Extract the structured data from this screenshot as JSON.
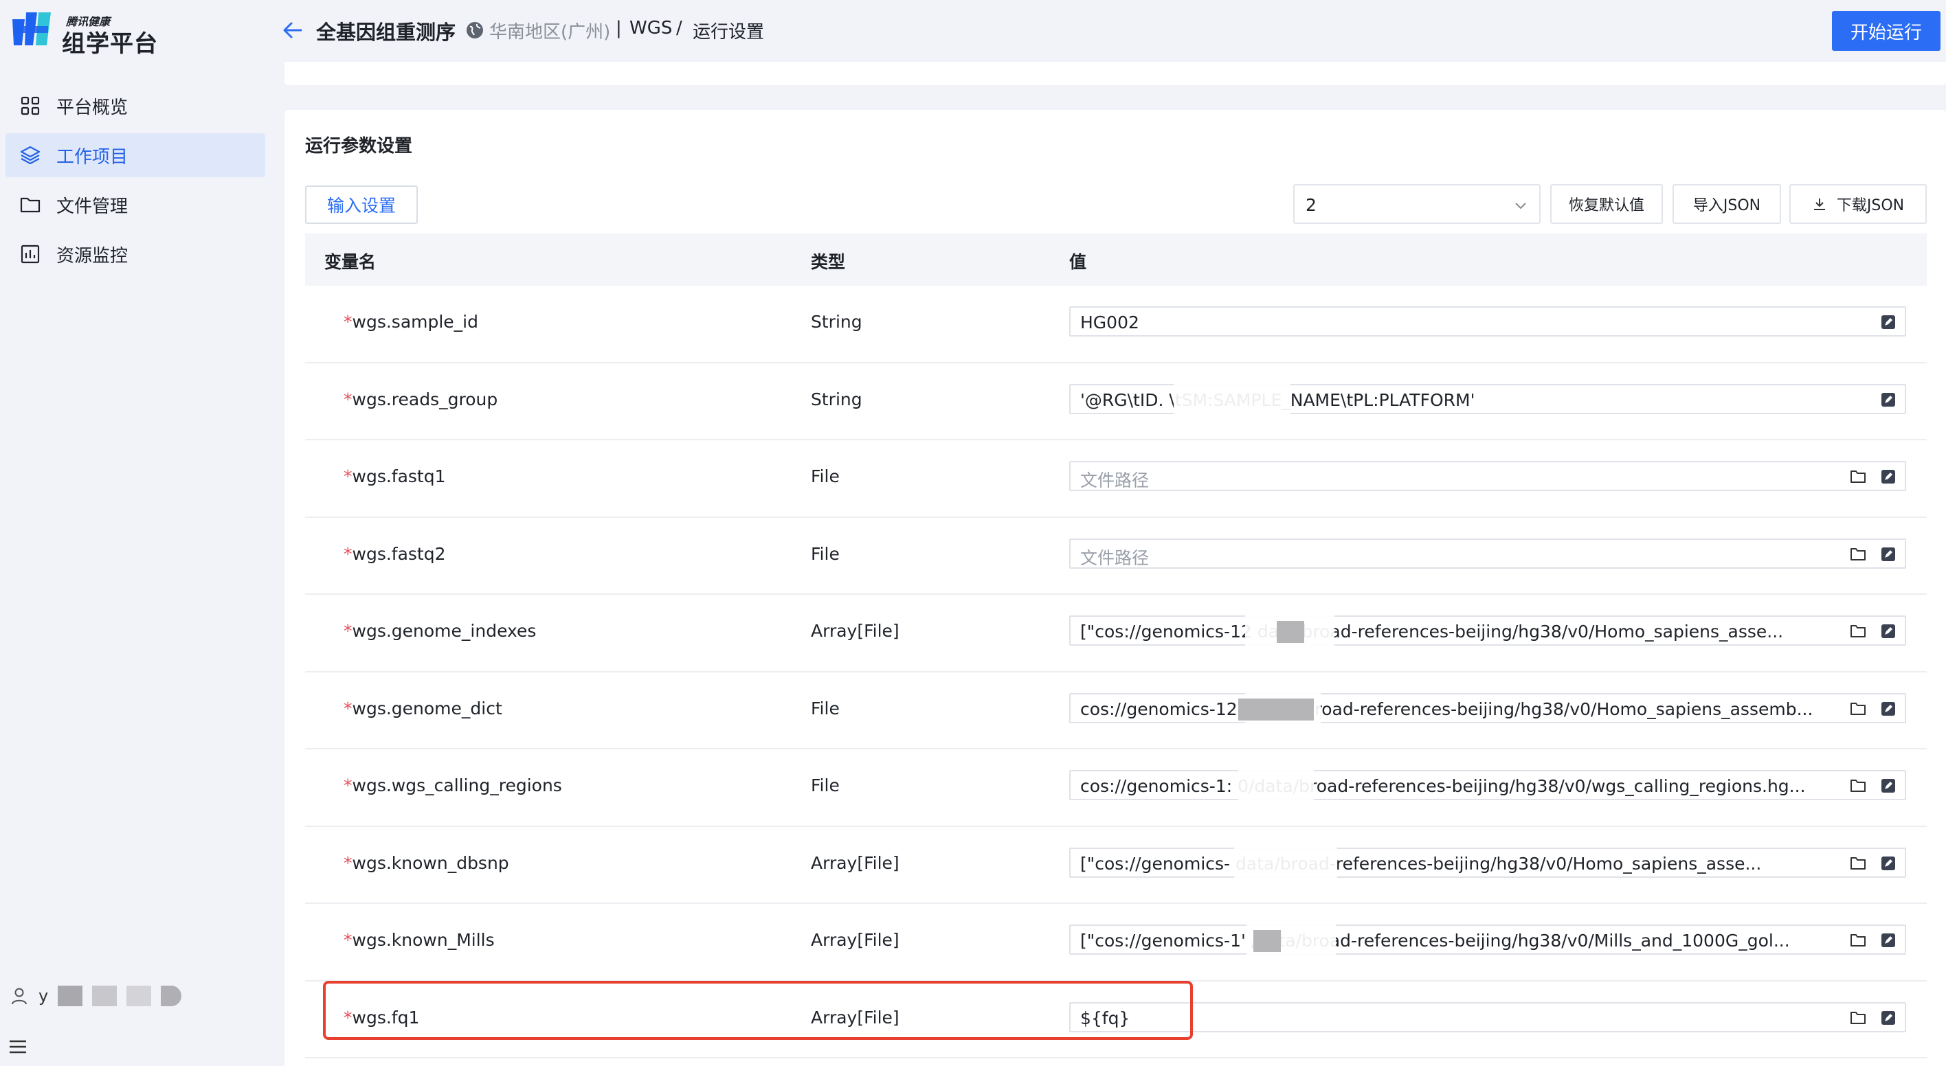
{
  "brand": {
    "small": "腾讯健康",
    "big": "组学平台"
  },
  "sidebar": {
    "items": [
      {
        "label": "平台概览",
        "icon": "grid-icon",
        "active": false
      },
      {
        "label": "工作项目",
        "icon": "layers-icon",
        "active": true
      },
      {
        "label": "文件管理",
        "icon": "folder-icon",
        "active": false
      },
      {
        "label": "资源监控",
        "icon": "chart-icon",
        "active": false
      }
    ],
    "user_initial": "y"
  },
  "header": {
    "title": "全基因组重测序",
    "region": "华南地区(广州)",
    "sep1": "|",
    "project": "WGS",
    "sep2": "/",
    "page": "运行设置",
    "start_button": "开始运行"
  },
  "params": {
    "title": "运行参数设置",
    "tab": "输入设置",
    "select_value": "2",
    "restore_button": "恢复默认值",
    "import_button": "导入JSON",
    "download_button": "下载JSON",
    "columns": {
      "name": "变量名",
      "type": "类型",
      "value": "值"
    },
    "required_mark": "*",
    "rows": [
      {
        "name": "wgs.sample_id",
        "type": "String",
        "value": "HG002",
        "placeholder": false,
        "folder": false
      },
      {
        "name": "wgs.reads_group",
        "type": "String",
        "value": "'@RG\\tID.                    \\tSM:SAMPLE_NAME\\tPL:PLATFORM'",
        "placeholder": false,
        "folder": false
      },
      {
        "name": "wgs.fastq1",
        "type": "File",
        "value": "文件路径",
        "placeholder": true,
        "folder": true
      },
      {
        "name": "wgs.fastq2",
        "type": "File",
        "value": "文件路径",
        "placeholder": true,
        "folder": true
      },
      {
        "name": "wgs.genome_indexes",
        "type": "Array[File]",
        "value": "[\"cos://genomics-12              data/broad-references-beijing/hg38/v0/Homo_sapiens_asse...",
        "placeholder": false,
        "folder": true
      },
      {
        "name": "wgs.genome_dict",
        "type": "File",
        "value": "cos://genomics-12            0/data/broad-references-beijing/hg38/v0/Homo_sapiens_assemb...",
        "placeholder": false,
        "folder": true
      },
      {
        "name": "wgs.wgs_calling_regions",
        "type": "File",
        "value": "cos://genomics-1:             0/data/broad-references-beijing/hg38/v0/wgs_calling_regions.hg...",
        "placeholder": false,
        "folder": true
      },
      {
        "name": "wgs.known_dbsnp",
        "type": "Array[File]",
        "value": "[\"cos://genomics-                   data/broad-references-beijing/hg38/v0/Homo_sapiens_asse...",
        "placeholder": false,
        "folder": true
      },
      {
        "name": "wgs.known_Mills",
        "type": "Array[File]",
        "value": "[\"cos://genomics-1'              /data/broad-references-beijing/hg38/v0/Mills_and_1000G_gol...",
        "placeholder": false,
        "folder": true
      },
      {
        "name": "wgs.fq1",
        "type": "Array[File]",
        "value": "${fq}",
        "placeholder": false,
        "folder": true
      }
    ]
  },
  "colors": {
    "accent": "#2b6ef5",
    "highlight": "#e8402f",
    "required": "#e34d59"
  }
}
